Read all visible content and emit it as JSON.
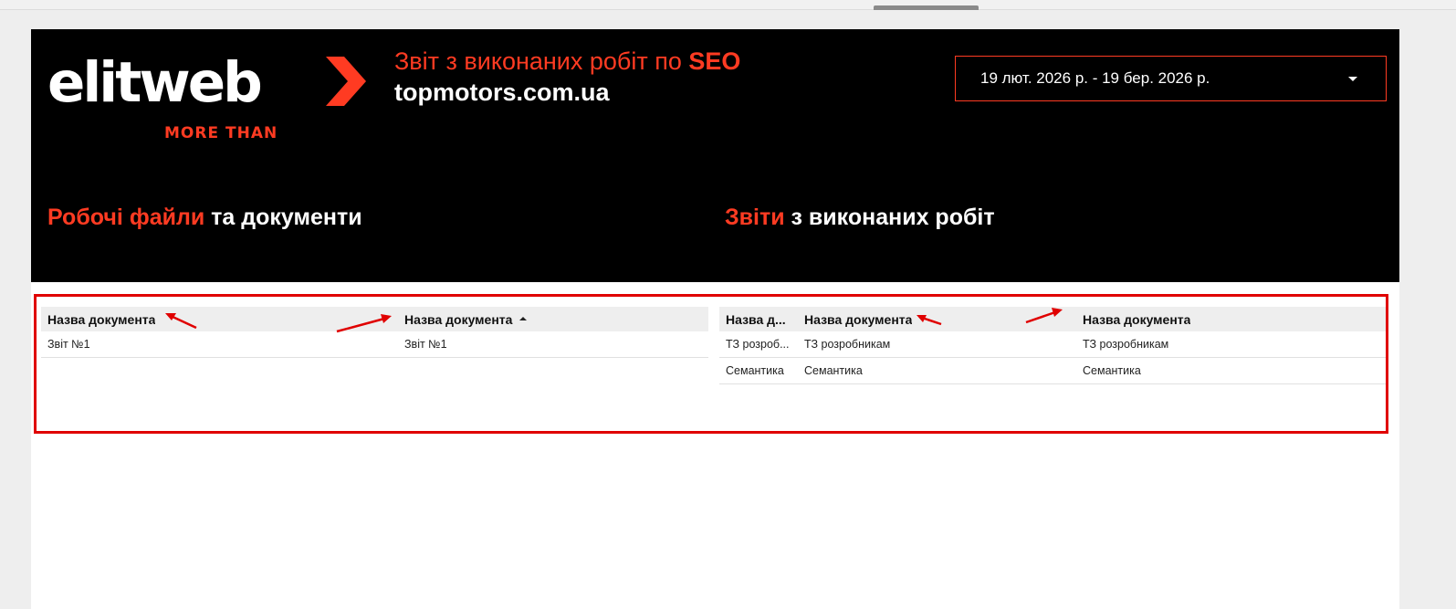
{
  "brand": {
    "logo_text": "elitweb",
    "logo_tagline": "MORE THAN",
    "accent_color": "#ff3b22"
  },
  "header": {
    "title_prefix": "Звіт з виконаних робіт по ",
    "title_bold": "SEO",
    "site": "topmotors.com.ua"
  },
  "date_range": {
    "value": "19 лют. 2026 р. - 19 бер. 2026 р.",
    "icon": "caret-down-icon"
  },
  "sections": {
    "left": {
      "accent": "Робочі файли",
      "rest": " та документи"
    },
    "right": {
      "accent": "Звіти",
      "rest": " з виконаних робіт"
    }
  },
  "left_table": {
    "headers": [
      "Назва документа",
      "Назва документа"
    ],
    "rows": [
      [
        "Звіт №1",
        "Звіт №1"
      ]
    ]
  },
  "right_table": {
    "headers": [
      "Назва д...",
      "Назва документа",
      "Назва документа"
    ],
    "rows": [
      [
        "ТЗ розроб...",
        "ТЗ розробникам",
        "ТЗ розробникам"
      ],
      [
        "Семантика",
        "Семантика",
        "Семантика"
      ]
    ]
  },
  "annotation_color": "#e00000"
}
